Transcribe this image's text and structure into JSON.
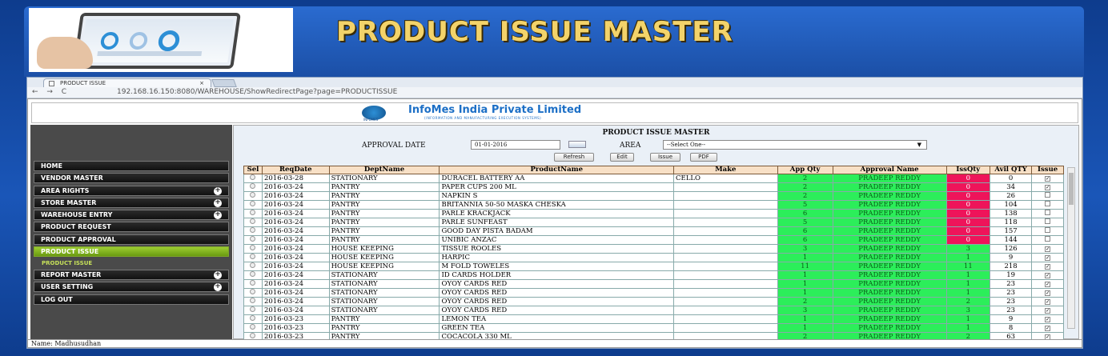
{
  "slide": {
    "title": "PRODUCT ISSUE MASTER"
  },
  "browser": {
    "tab_label": "PRODUCT ISSUE",
    "tab_close": "×",
    "nav_glyphs": "← → C",
    "url": "192.168.16.150:8080/WAREHOUSE/ShowRedirectPage?page=PRODUCTISSUE"
  },
  "banner": {
    "company": "InfoMes India Private Limited",
    "company_sub": "(INFORMATION AND MANUFACTURING EXECUTION SYSTEMS)",
    "logo_text": "INFOMES"
  },
  "sidebar": {
    "items": [
      {
        "label": "HOME",
        "plus": ""
      },
      {
        "label": "VENDOR MASTER",
        "plus": ""
      },
      {
        "label": "AREA RIGHTS",
        "plus": "+"
      },
      {
        "label": "STORE MASTER",
        "plus": "+"
      },
      {
        "label": "WAREHOUSE ENTRY",
        "plus": "+"
      },
      {
        "label": "PRODUCT REQUEST",
        "plus": ""
      },
      {
        "label": "PRODUCT APPROVAL",
        "plus": ""
      },
      {
        "label": "PRODUCT ISSUE",
        "plus": ""
      }
    ],
    "sub_item": "PRODUCT ISSUE",
    "items2": [
      {
        "label": "REPORT MASTER",
        "plus": "+"
      },
      {
        "label": "USER SETTING",
        "plus": "+"
      },
      {
        "label": "LOG OUT",
        "plus": ""
      }
    ]
  },
  "content": {
    "title": "PRODUCT ISSUE MASTER",
    "approval_date_label": "APPROVAL DATE",
    "approval_date_value": "01-01-2016",
    "area_label": "AREA",
    "area_value": "--Select One--",
    "buttons": {
      "refresh": "Refresh",
      "edit": "Edit",
      "issue": "Issue",
      "pdf": "PDF"
    }
  },
  "table": {
    "headers": [
      "Sel",
      "ReqDate",
      "DeptName",
      "ProductName",
      "Make",
      "App Qty",
      "Approval Name",
      "IssQty",
      "Avil QTY",
      "Issue"
    ],
    "rows": [
      [
        "2016-03-28",
        "STATIONARY",
        "DURACEL BATTERY AA",
        "CELLO",
        "2",
        "PRADEEP REDDY",
        "0",
        "0",
        "1"
      ],
      [
        "2016-03-24",
        "PANTRY",
        "PAPER CUPS 200 ML",
        "",
        "2",
        "PRADEEP REDDY",
        "0",
        "34",
        "1"
      ],
      [
        "2016-03-24",
        "PANTRY",
        "NAPKIN S",
        "",
        "2",
        "PRADEEP REDDY",
        "0",
        "26",
        "0"
      ],
      [
        "2016-03-24",
        "PANTRY",
        "BRITANNIA 50-50 MASKA CHESKA",
        "",
        "5",
        "PRADEEP REDDY",
        "0",
        "104",
        "0"
      ],
      [
        "2016-03-24",
        "PANTRY",
        "PARLE KRACKJACK",
        "",
        "6",
        "PRADEEP REDDY",
        "0",
        "138",
        "0"
      ],
      [
        "2016-03-24",
        "PANTRY",
        "PARLE SUNFEAST",
        "",
        "5",
        "PRADEEP REDDY",
        "0",
        "118",
        "0"
      ],
      [
        "2016-03-24",
        "PANTRY",
        "GOOD DAY PISTA BADAM",
        "",
        "6",
        "PRADEEP REDDY",
        "0",
        "157",
        "0"
      ],
      [
        "2016-03-24",
        "PANTRY",
        "UNIBIC ANZAC",
        "",
        "6",
        "PRADEEP REDDY",
        "0",
        "144",
        "0"
      ],
      [
        "2016-03-24",
        "HOUSE KEEPING",
        "TISSUE ROOLES",
        "",
        "3",
        "PRADEEP REDDY",
        "3",
        "126",
        "1"
      ],
      [
        "2016-03-24",
        "HOUSE KEEPING",
        "HARPIC",
        "",
        "1",
        "PRADEEP REDDY",
        "1",
        "9",
        "1"
      ],
      [
        "2016-03-24",
        "HOUSE KEEPING",
        "M FOLD TOWELES",
        "",
        "11",
        "PRADEEP REDDY",
        "11",
        "218",
        "1"
      ],
      [
        "2016-03-24",
        "STATIONARY",
        "ID CARDS HOLDER",
        "",
        "1",
        "PRADEEP REDDY",
        "1",
        "19",
        "1"
      ],
      [
        "2016-03-24",
        "STATIONARY",
        "OYOY CARDS RED",
        "",
        "1",
        "PRADEEP REDDY",
        "1",
        "23",
        "1"
      ],
      [
        "2016-03-24",
        "STATIONARY",
        "OYOY CARDS RED",
        "",
        "1",
        "PRADEEP REDDY",
        "1",
        "23",
        "1"
      ],
      [
        "2016-03-24",
        "STATIONARY",
        "OYOY CARDS RED",
        "",
        "2",
        "PRADEEP REDDY",
        "2",
        "23",
        "1"
      ],
      [
        "2016-03-24",
        "STATIONARY",
        "OYOY CARDS RED",
        "",
        "3",
        "PRADEEP REDDY",
        "3",
        "23",
        "1"
      ],
      [
        "2016-03-23",
        "PANTRY",
        "LEMON TEA",
        "",
        "1",
        "PRADEEP REDDY",
        "1",
        "9",
        "1"
      ],
      [
        "2016-03-23",
        "PANTRY",
        "GREEN TEA",
        "",
        "1",
        "PRADEEP REDDY",
        "1",
        "8",
        "1"
      ],
      [
        "2016-03-23",
        "PANTRY",
        "COCACOLA 330 ML",
        "",
        "2",
        "PRADEEP REDDY",
        "2",
        "63",
        "1"
      ]
    ]
  },
  "status": "Name: Madhusudhan",
  "colors": {
    "approved_green": "#2cee5a",
    "pending_red": "#ee145a",
    "menu_active": "#9ccd32",
    "title_gold": "#f3d36a"
  }
}
